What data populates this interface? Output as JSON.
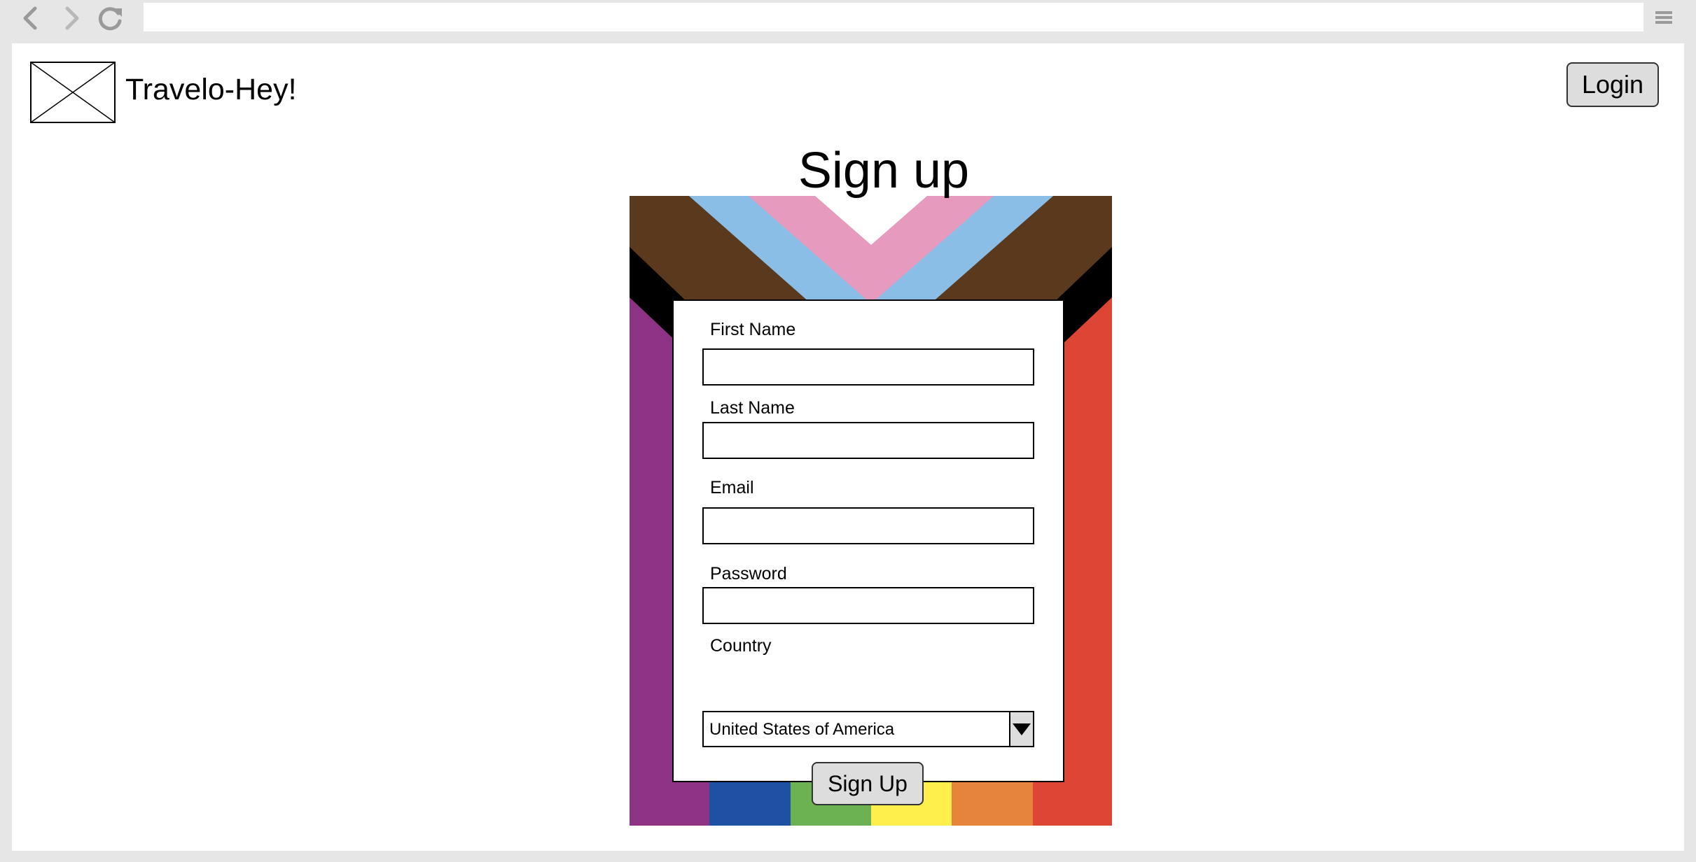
{
  "browser": {
    "back_icon": "chevron-left-icon",
    "forward_icon": "chevron-right-icon",
    "reload_icon": "reload-icon",
    "menu_icon": "hamburger-menu-icon",
    "url": ""
  },
  "header": {
    "logo_icon": "image-placeholder-icon",
    "brand_name": "Travelo-Hey!",
    "login_label": "Login"
  },
  "main": {
    "title": "Sign up"
  },
  "form": {
    "first_name_label": "First Name",
    "first_name_value": "",
    "last_name_label": "Last Name",
    "last_name_value": "",
    "email_label": "Email",
    "email_value": "",
    "password_label": "Password",
    "password_value": "",
    "country_label": "Country",
    "country_value": "United States of America",
    "submit_label": "Sign Up"
  },
  "colors": {
    "purple": "#8e3285",
    "blue": "#1d52a2",
    "green": "#6cb253",
    "yellow": "#feef4c",
    "orange": "#e6843e",
    "red": "#dd4534",
    "black": "#000000",
    "brown": "#5a391c",
    "light_blue": "#8bbee6",
    "pink": "#e69abd"
  }
}
